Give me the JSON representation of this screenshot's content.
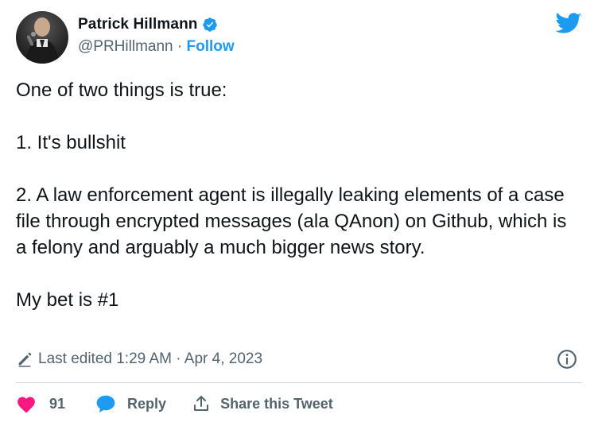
{
  "author": {
    "name": "Patrick Hillmann",
    "handle": "@PRHillmann",
    "separator": " · ",
    "follow_label": "Follow"
  },
  "tweet": {
    "lines": [
      "One of two things is true:",
      "",
      "1. It's bullshit",
      "",
      "2. A law enforcement agent is illegally leaking elements of a case file through encrypted messages (ala QAnon) on Github, which is a felony and arguably a much bigger news story.",
      "",
      "My bet is #1"
    ],
    "edited": "Last edited 1:29 AM · Apr 4, 2023"
  },
  "actions": {
    "like_count": "91",
    "reply_label": "Reply",
    "share_label": "Share this Tweet"
  },
  "colors": {
    "brand": "#1d9bf0",
    "like": "#f91880",
    "text": "#0f1419",
    "muted": "#536471"
  },
  "icons": [
    "verified-badge-icon",
    "twitter-bird-icon",
    "pencil-icon",
    "info-icon",
    "heart-icon",
    "reply-bubble-icon",
    "share-icon"
  ]
}
